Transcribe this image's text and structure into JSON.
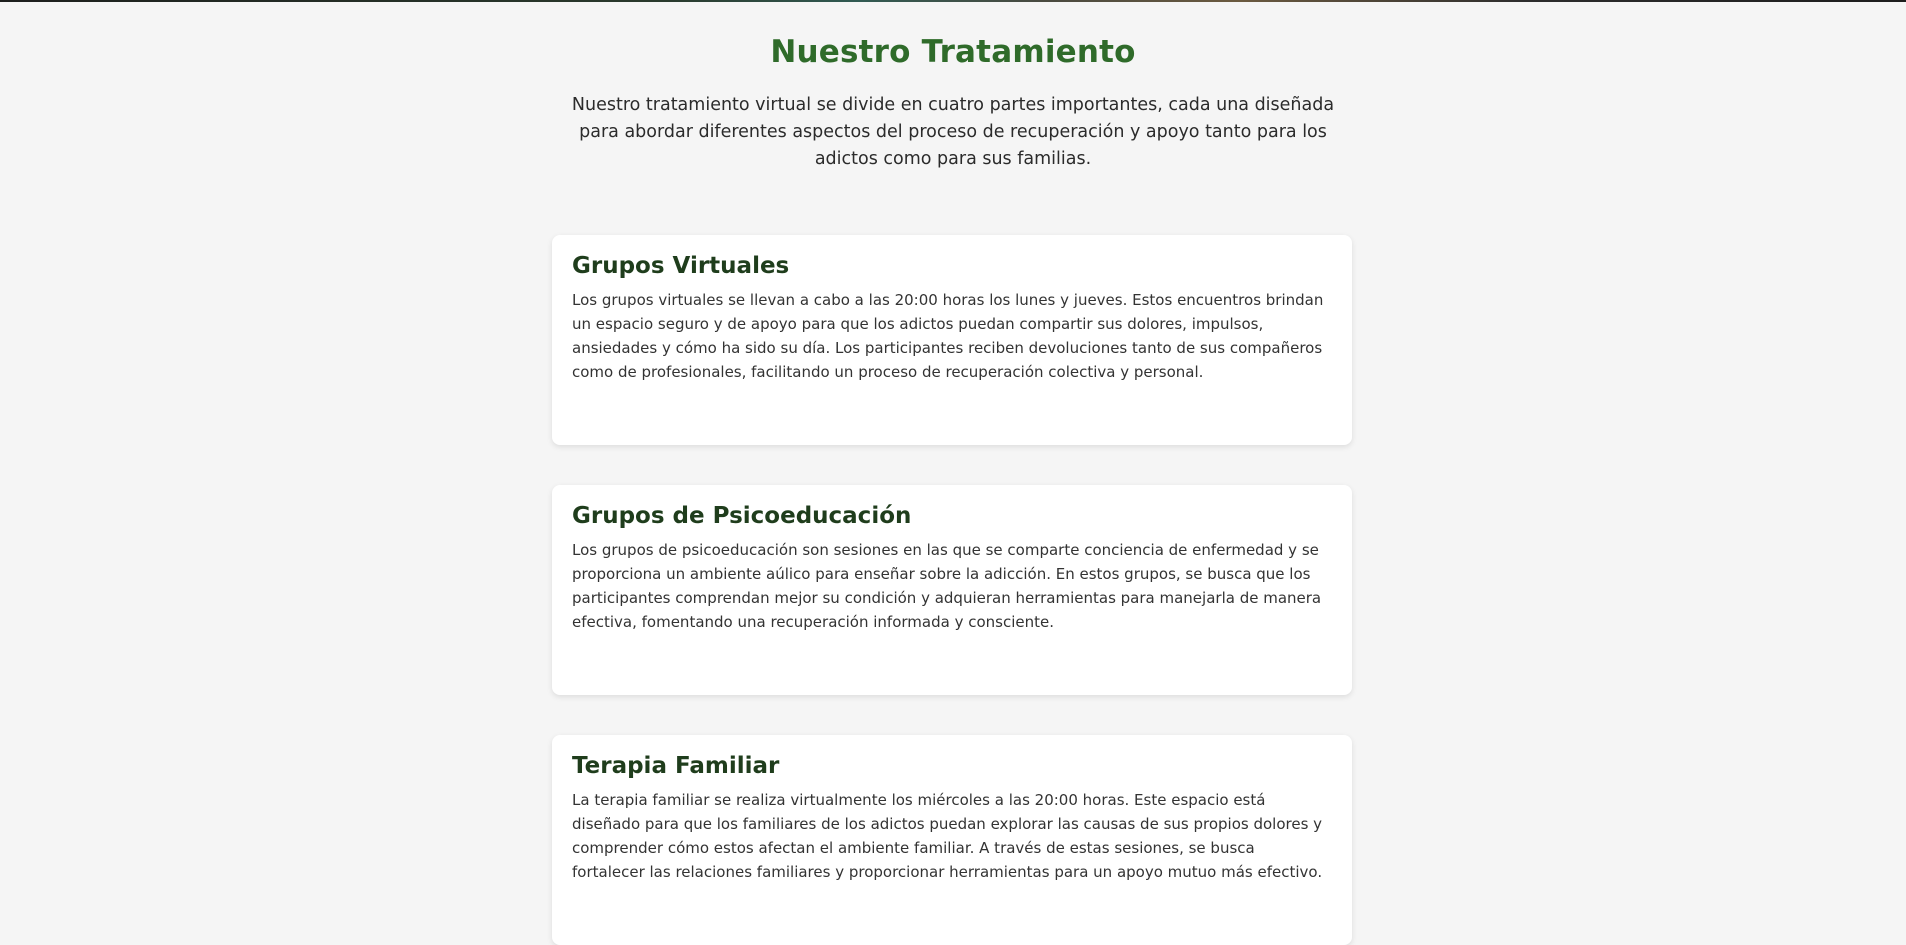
{
  "header": {
    "title": "Nuestro Tratamiento",
    "intro": "Nuestro tratamiento virtual se divide en cuatro partes importantes, cada una diseñada para abordar diferentes aspectos del proceso de recuperación y apoyo tanto para los adictos como para sus familias."
  },
  "cards": [
    {
      "title": "Grupos Virtuales",
      "text": "Los grupos virtuales se llevan a cabo a las 20:00 horas los lunes y jueves. Estos encuentros brindan un espacio seguro y de apoyo para que los adictos puedan compartir sus dolores, impulsos, ansiedades y cómo ha sido su día. Los participantes reciben devoluciones tanto de sus compañeros como de profesionales, facilitando un proceso de recuperación colectiva y personal."
    },
    {
      "title": "Grupos de Psicoeducación",
      "text": "Los grupos de psicoeducación son sesiones en las que se comparte conciencia de enfermedad y se proporciona un ambiente aúlico para enseñar sobre la adicción. En estos grupos, se busca que los participantes comprendan mejor su condición y adquieran herramientas para manejarla de manera efectiva, fomentando una recuperación informada y consciente."
    },
    {
      "title": "Terapia Familiar",
      "text": "La terapia familiar se realiza virtualmente los miércoles a las 20:00 horas. Este espacio está diseñado para que los familiares de los adictos puedan explorar las causas de sus propios dolores y comprender cómo estos afectan el ambiente familiar. A través de estas sesiones, se busca fortalecer las relaciones familiares y proporcionar herramientas para un apoyo mutuo más efectivo."
    }
  ]
}
